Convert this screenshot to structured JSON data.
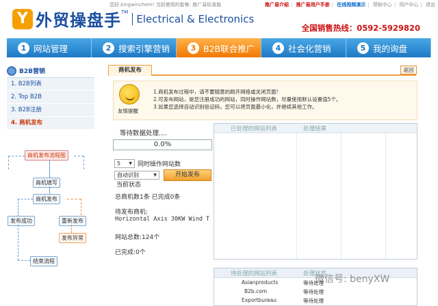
{
  "topbar": {
    "welcome": "您好,kingwinchem! 当前使用的套餐: 推广易标准版",
    "links": [
      {
        "label": "推广易介绍",
        "style": "red"
      },
      {
        "label": "推广易用户手册",
        "style": "red"
      },
      {
        "label": "在线视频演示",
        "style": "blue"
      },
      {
        "label": "帮助中心",
        "style": "plain"
      },
      {
        "label": "用户中心",
        "style": "plain"
      },
      {
        "label": "退出",
        "style": "plain"
      }
    ]
  },
  "brand": {
    "logo_mark": "Y",
    "name_cn": "外贸操盘手",
    "tm": "TM",
    "name_en": "Electrical & Electronics",
    "hotline": "全国销售热线：0592-5929820"
  },
  "nav": [
    {
      "num": "1",
      "label": "网站管理",
      "active": false
    },
    {
      "num": "2",
      "label": "搜索引擎营销",
      "active": false
    },
    {
      "num": "3",
      "label": "B2B联合推广",
      "active": true
    },
    {
      "num": "4",
      "label": "社会化营销",
      "active": false
    },
    {
      "num": "5",
      "label": "我的询盘",
      "active": false
    }
  ],
  "sidebar": {
    "heading": "B2B营销",
    "items": [
      {
        "label": "1. B2B列表",
        "active": false
      },
      {
        "label": "2. Top B2B",
        "active": false
      },
      {
        "label": "3. B2B注册",
        "active": false
      },
      {
        "label": "4. 商机发布",
        "active": true
      }
    ]
  },
  "flow": {
    "title": "商机发布流程图",
    "step_fill": "商机填写",
    "step_publish": "商机发布",
    "success": "发布成功",
    "republish": "重新发布",
    "error": "发布异常",
    "end": "结束流程"
  },
  "tab": {
    "label": "商机发布",
    "back": "返回"
  },
  "notice": {
    "mascot_label": "友情提醒",
    "lines": [
      "1.商机发布过程中，请不要随意的刷开网络或关闭页面!",
      "2.可发布网站，是您注册成功的网站，同时操作网站数，尽量使用默认设置值5个。",
      "3.如果您选择自动识别验证码，您可以将页面最小化，并继续其他工作。"
    ]
  },
  "publish": {
    "waiting_title": "等待数据处理....",
    "progress_text": "0.0%",
    "concurrent_value": "5",
    "concurrent_label": "同时操作网站数",
    "captcha_mode": "自动识别",
    "start_button": "开始发布",
    "current_status": "当前状态",
    "totals": "总商机数1条  已完成0条",
    "pending_label": "待发布商机:",
    "pending_item": "Horizontal Axis 30KW Wind T",
    "site_total": "网站总数:124个",
    "completed": "已完成:0个"
  },
  "results_panel": {
    "col1": "已处理的网站列表",
    "col2": "处理结果"
  },
  "queue_panel": {
    "col1": "待处理的网站列表",
    "col2": "处理状态",
    "rows": [
      {
        "site": "Asianproducts",
        "status": "等待处理"
      },
      {
        "site": "B2b.com",
        "status": "等待处理"
      },
      {
        "site": "Exportbureau",
        "status": "等待处理"
      }
    ]
  },
  "watermark": "微信号: benyXW",
  "colors": {
    "brand_blue": "#1a4fa0",
    "nav_blue": "#1d79c4",
    "nav_active": "#f07800",
    "hotline_red": "#cc1111"
  }
}
